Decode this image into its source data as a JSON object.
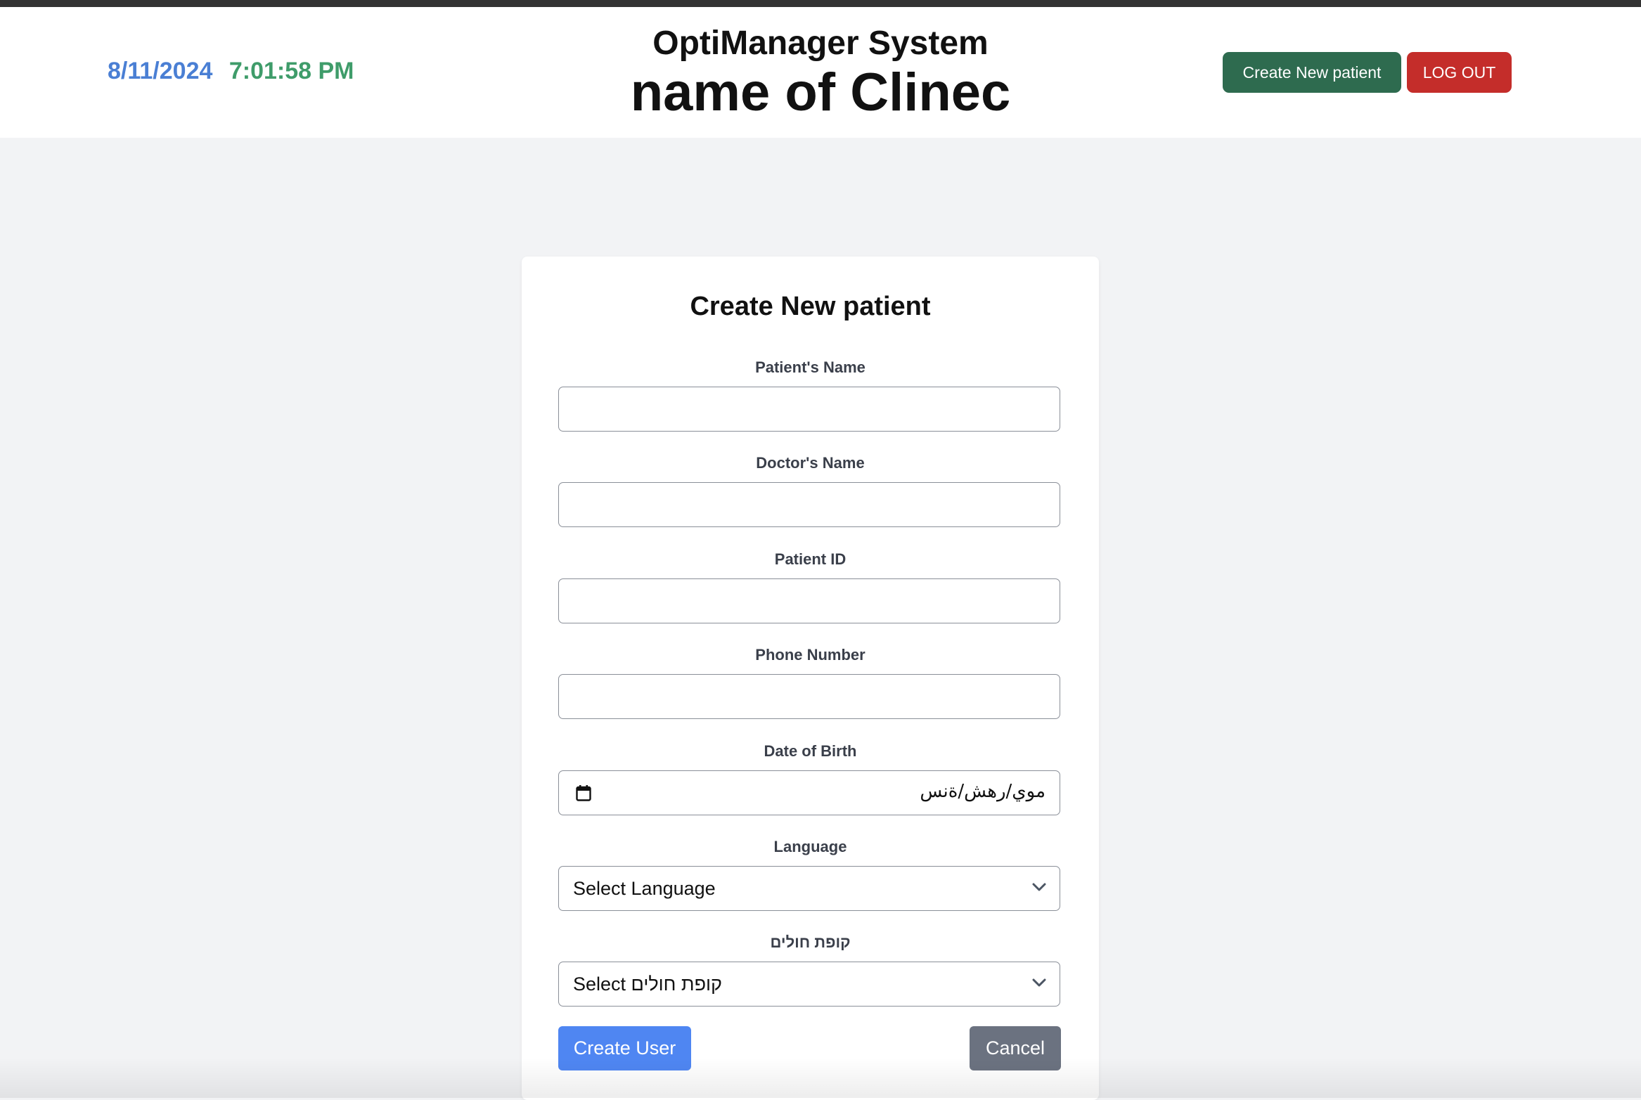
{
  "header": {
    "date": "8/11/2024",
    "time": "7:01:58 PM",
    "app_title": "OptiManager System",
    "clinic_name": "name of Clinec",
    "create_patient_label": "Create New patient",
    "logout_label": "LOG OUT"
  },
  "form": {
    "title": "Create New patient",
    "fields": [
      {
        "label": "Patient's Name",
        "value": ""
      },
      {
        "label": "Doctor's Name",
        "value": ""
      },
      {
        "label": "Patient ID",
        "value": ""
      },
      {
        "label": "Phone Number",
        "value": ""
      }
    ],
    "dob": {
      "label": "Date of Birth",
      "placeholder": "موي/رهش/ةنس",
      "icon": "calendar-icon"
    },
    "language": {
      "label": "Language",
      "selected": "Select Language",
      "icon": "chevron-down-icon"
    },
    "hmo": {
      "label": "קופת חולים",
      "selected": "Select קופת חולים",
      "icon": "chevron-down-icon"
    },
    "submit_label": "Create User",
    "cancel_label": "Cancel"
  },
  "colors": {
    "date": "#4a7fd4",
    "time": "#3f9c6a",
    "create_button": "#2e6b4f",
    "logout_button": "#c42d2a",
    "submit_button": "#4f86f2",
    "cancel_button": "#6b7280"
  }
}
